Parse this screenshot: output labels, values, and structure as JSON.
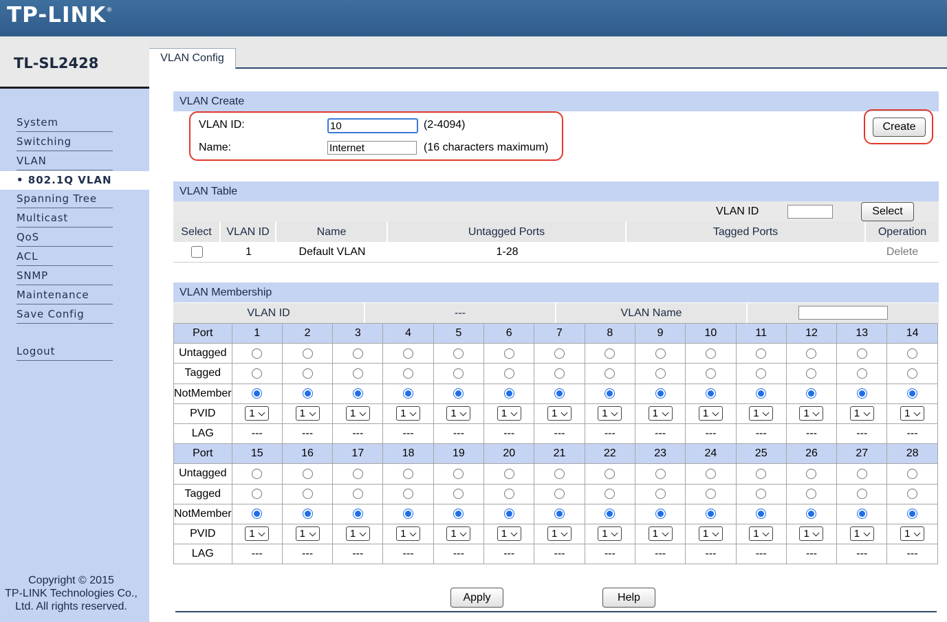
{
  "brand": {
    "logo": "TP-LINK",
    "reg": "®",
    "model": "TL-SL2428"
  },
  "sidebar": {
    "items": [
      {
        "label": "System"
      },
      {
        "label": "Switching"
      },
      {
        "label": "VLAN"
      },
      {
        "label": "• 802.1Q VLAN",
        "active": true
      },
      {
        "label": "Spanning Tree"
      },
      {
        "label": "Multicast"
      },
      {
        "label": "QoS"
      },
      {
        "label": "ACL"
      },
      {
        "label": "SNMP"
      },
      {
        "label": "Maintenance"
      },
      {
        "label": "Save Config"
      },
      {
        "label": "Logout"
      }
    ],
    "copyright": [
      "Copyright © 2015",
      "TP-LINK Technologies Co.,",
      "Ltd. All rights reserved."
    ]
  },
  "tabs": [
    {
      "label": "VLAN Config",
      "active": true
    }
  ],
  "vlan_create": {
    "title": "VLAN Create",
    "vlan_id_label": "VLAN ID:",
    "vlan_id_value": "10",
    "vlan_id_hint": "(2-4094)",
    "name_label": "Name:",
    "name_value": "Internet",
    "name_hint": "(16 characters maximum)",
    "create_button": "Create"
  },
  "vlan_table": {
    "title": "VLAN Table",
    "filter_label": "VLAN ID",
    "filter_value": "",
    "select_button": "Select",
    "columns": [
      "Select",
      "VLAN ID",
      "Name",
      "Untagged Ports",
      "Tagged Ports",
      "Operation"
    ],
    "rows": [
      {
        "vlan_id": "1",
        "name": "Default VLAN",
        "untagged": "1-28",
        "tagged": "",
        "operation": "Delete"
      }
    ]
  },
  "membership": {
    "title": "VLAN Membership",
    "vlan_id_label": "VLAN ID",
    "vlan_id_value": "---",
    "vlan_name_label": "VLAN Name",
    "vlan_name_value": "",
    "row_labels": [
      "Port",
      "Untagged",
      "Tagged",
      "NotMember",
      "PVID",
      "LAG"
    ],
    "ports_block1": [
      "1",
      "2",
      "3",
      "4",
      "5",
      "6",
      "7",
      "8",
      "9",
      "10",
      "11",
      "12",
      "13",
      "14"
    ],
    "ports_block2": [
      "15",
      "16",
      "17",
      "18",
      "19",
      "20",
      "21",
      "22",
      "23",
      "24",
      "25",
      "26",
      "27",
      "28"
    ],
    "selected_membership": "NotMember",
    "pvid_value": "1",
    "lag_value": "---"
  },
  "footer": {
    "apply_button": "Apply",
    "help_button": "Help"
  },
  "colors": {
    "header": "#2e5b8a",
    "sidebar": "#c4d3f2",
    "section": "#c6d4f3",
    "highlight": "#e0392b",
    "radio": "#1f6ee8"
  }
}
